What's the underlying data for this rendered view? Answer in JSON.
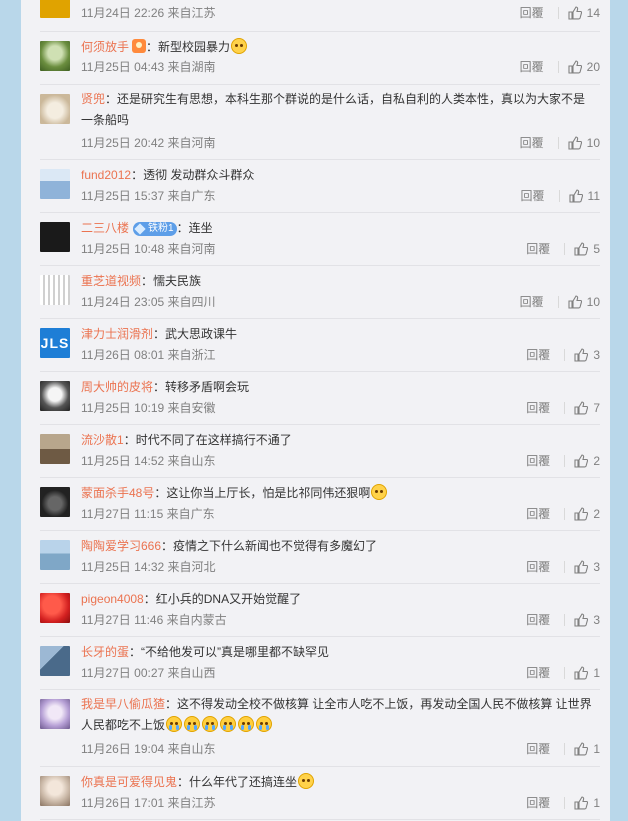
{
  "reply_label": "回覆",
  "comments": [
    {
      "user": "",
      "text": "",
      "time": "11月24日 22:26",
      "location": "来自江苏",
      "likes": "14",
      "avatar_color": "#e0a300"
    },
    {
      "user": "何须放手",
      "text": "：新型校园暴力",
      "time": "11月25日 04:43",
      "location": "来自湖南",
      "likes": "20",
      "avatar_color": "#6b8e3f"
    },
    {
      "user": "贤兜",
      "text": "：还是研究生有思想，本科生那个群说的是什么话，自私自利的人类本性，真以为大家不是",
      "text2": "一条船吗",
      "time": "11月25日 20:42",
      "location": "来自河南",
      "likes": "10",
      "avatar_color": "#cbb89a"
    },
    {
      "user": "fund2012",
      "text": "：透彻 发动群众斗群众",
      "time": "11月25日 15:37",
      "location": "来自广东",
      "likes": "11",
      "avatar_color": "#8fb3d9"
    },
    {
      "user": "二三八楼",
      "badge": "铁粉1",
      "text": "：连坐",
      "time": "11月25日 10:48",
      "location": "来自河南",
      "likes": "5",
      "avatar_color": "#1a1a1a"
    },
    {
      "user": "重芝道视频",
      "text": "：懦夫民族",
      "time": "11月24日 23:05",
      "location": "来自四川",
      "likes": "10",
      "avatar_color": "#d9d9d9"
    },
    {
      "user": "津力士润滑剂",
      "text": "：武大思政课牛",
      "time": "11月26日 08:01",
      "location": "来自浙江",
      "likes": "3",
      "avatar_color": "#1e7ed6",
      "avatar_text": "JLS"
    },
    {
      "user": "周大帅的皮将",
      "text": "：转移矛盾啊会玩",
      "time": "11月25日 10:19",
      "location": "来自安徽",
      "likes": "7",
      "avatar_color": "#555555"
    },
    {
      "user": "流沙散1",
      "text": "：时代不同了在这样搞行不通了",
      "time": "11月25日 14:52",
      "location": "来自山东",
      "likes": "2",
      "avatar_color": "#6e5a44"
    },
    {
      "user": "蒙面杀手48号",
      "text": "：这让你当上厅长，怕是比祁同伟还狠啊",
      "time": "11月27日 11:15",
      "location": "来自广东",
      "likes": "2",
      "avatar_color": "#222222"
    },
    {
      "user": "陶陶爱学习666",
      "text": "：疫情之下什么新闻也不觉得有多魔幻了",
      "time": "11月25日 14:32",
      "location": "来自河北",
      "likes": "3",
      "avatar_color": "#7fa7c7"
    },
    {
      "user": "pigeon4008",
      "text": "：红小兵的DNA又开始觉醒了",
      "time": "11月27日 11:46",
      "location": "来自内蒙古",
      "likes": "3",
      "avatar_color": "#d32020"
    },
    {
      "user": "长牙的蛋",
      "text": "：“不给他发可以”真是哪里都不缺罕见",
      "time": "11月27日 00:27",
      "location": "来自山西",
      "likes": "1",
      "avatar_color": "#4a6a8a"
    },
    {
      "user": "我是早八偷瓜猹",
      "text": "：这不得发动全校不做核算 让全市人吃不上饭，再发动全国人民不做核算 让世界",
      "text2": "人民都吃不上饭",
      "time": "11月26日 19:04",
      "location": "来自山东",
      "likes": "1",
      "avatar_color": "#b7a1d6"
    },
    {
      "user": "你真是可爱得见鬼",
      "text": "：什么年代了还搞连坐",
      "time": "11月26日 17:01",
      "location": "来自江苏",
      "likes": "1",
      "avatar_color": "#c9b7a6"
    }
  ]
}
